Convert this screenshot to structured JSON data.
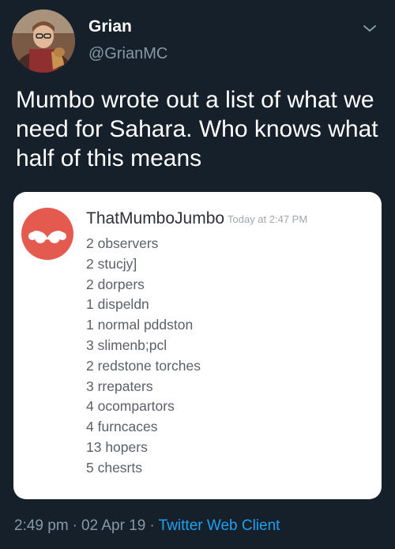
{
  "tweet": {
    "display_name": "Grian",
    "handle": "@GrianMC",
    "text": "Mumbo wrote out a list of what we need for Sahara. Who knows what half of this means",
    "meta": {
      "time": "2:49 pm",
      "separator": "·",
      "date": "02 Apr 19",
      "client": "Twitter Web Client"
    }
  },
  "discord_message": {
    "author": "ThatMumboJumbo",
    "timestamp": "Today at 2:47 PM",
    "lines": [
      "2 observers",
      "2 stucjy]",
      "2 dorpers",
      "1 dispeldn",
      "1 normal pddston",
      "3 slimenb;pcl",
      "2 redstone torches",
      "3 rrepaters",
      "4 ocompartors",
      "4 furncaces",
      "13 hopers",
      "5 chesrts"
    ],
    "avatar_color": "#e55a4f"
  },
  "colors": {
    "background": "#15202b",
    "secondary_text": "#8899a6",
    "link": "#1da1f2"
  },
  "icons": {
    "menu": "chevron-down-icon",
    "discord_avatar": "mustache-icon"
  }
}
